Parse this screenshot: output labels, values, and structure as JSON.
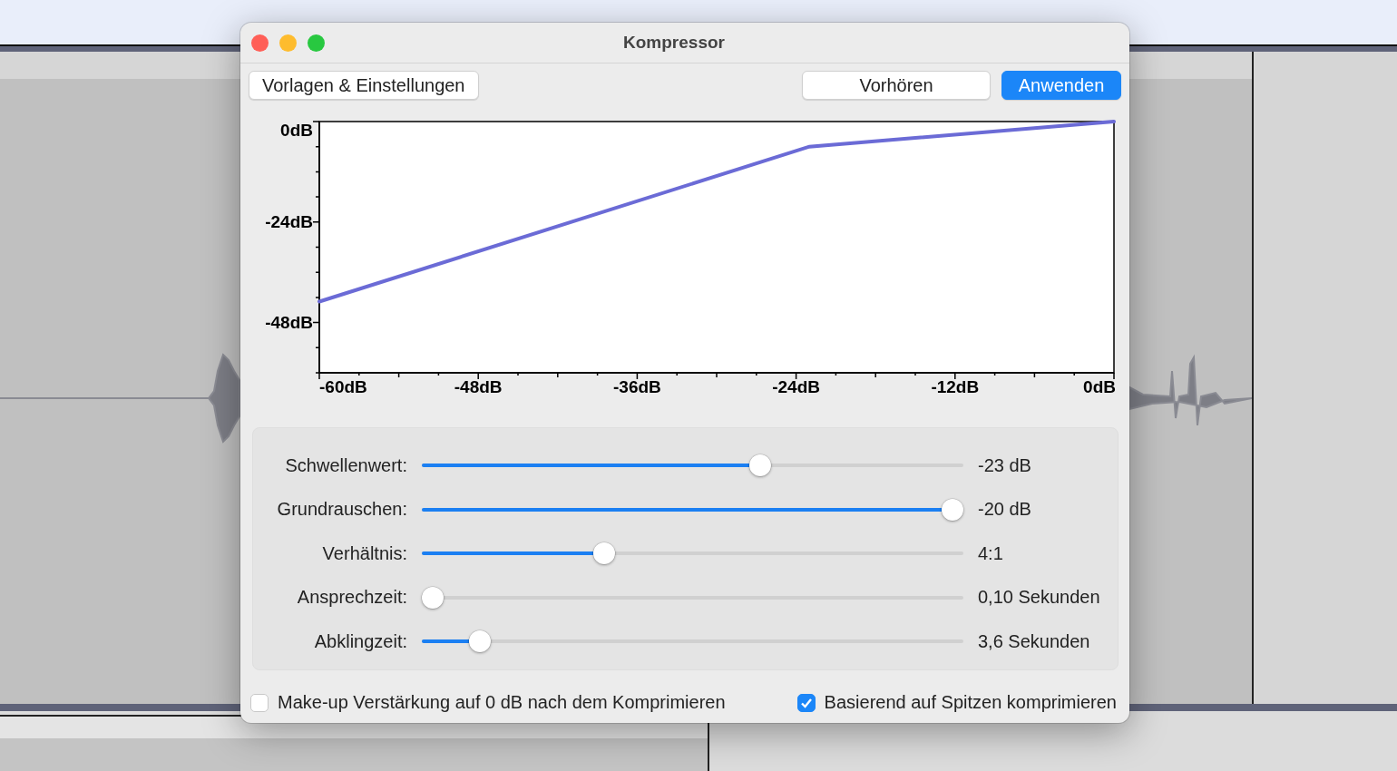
{
  "window": {
    "title": "Kompressor"
  },
  "toolbar": {
    "presets_button": "Vorlagen & Einstellungen",
    "actions": [
      {
        "label": "Vorhören",
        "default": false
      },
      {
        "label": "Anwenden",
        "default": true
      }
    ]
  },
  "chart": {
    "chart_data": {
      "type": "line",
      "x": [
        -60,
        -23,
        0
      ],
      "series": [
        {
          "color": "#6b6bd6",
          "values": [
            -43,
            -6,
            0
          ]
        }
      ],
      "xlim": [
        -60,
        0
      ],
      "ylim": [
        -60,
        0
      ],
      "xticks": [
        {
          "value": -60,
          "label": "-60dB"
        },
        {
          "value": -48,
          "label": "-48dB"
        },
        {
          "value": -36,
          "label": "-36dB"
        },
        {
          "value": -24,
          "label": "-24dB"
        },
        {
          "value": -12,
          "label": "-12dB"
        },
        {
          "value": 0,
          "label": "0dB"
        }
      ],
      "yticks": [
        {
          "value": 0,
          "label": "0dB"
        },
        {
          "value": -24,
          "label": "-24dB"
        },
        {
          "value": -48,
          "label": "-48dB"
        }
      ]
    }
  },
  "sliders": [
    {
      "label": "Schwellenwert:",
      "level": 0.63,
      "reading": "-23 dB"
    },
    {
      "label": "Grundrauschen:",
      "level": 1.0,
      "reading": "-20 dB"
    },
    {
      "label": "Verhältnis:",
      "level": 0.33,
      "reading": "4:1"
    },
    {
      "label": "Ansprechzeit:",
      "level": 0.0,
      "reading": "0,10 Sekunden"
    },
    {
      "label": "Abklingzeit:",
      "level": 0.09,
      "reading": "3,6 Sekunden"
    }
  ],
  "options": [
    {
      "label": "Make-up Verstärkung auf 0 dB nach dem Komprimieren",
      "checked": false
    },
    {
      "label": "Basierend auf Spitzen komprimieren",
      "checked": true
    }
  ]
}
